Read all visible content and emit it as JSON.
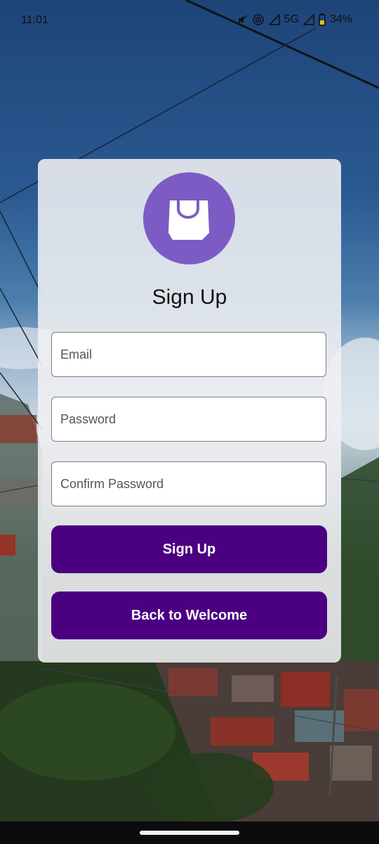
{
  "status_bar": {
    "time": "11:01",
    "network": "5G",
    "battery": "34%"
  },
  "logo": {
    "icon": "shopping-bag-icon",
    "circle_color": "#7c5cc4"
  },
  "form": {
    "title": "Sign Up",
    "email_placeholder": "Email",
    "password_placeholder": "Password",
    "confirm_placeholder": "Confirm Password",
    "signup_label": "Sign Up",
    "back_label": "Back to Welcome"
  },
  "colors": {
    "button": "#4b0082",
    "button_text": "#ffffff"
  }
}
